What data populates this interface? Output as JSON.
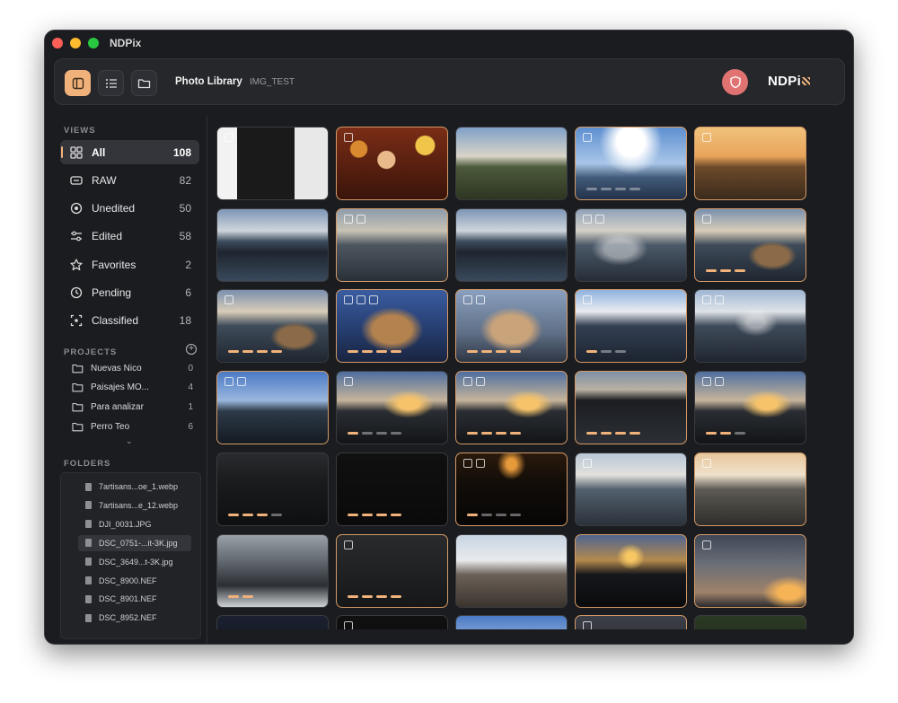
{
  "window": {
    "title": "NDPix"
  },
  "toolbar": {
    "title": "Photo Library",
    "subtitle": "IMG_TEST",
    "logo": "NDPi"
  },
  "accent": "#f0b27a",
  "sidebar": {
    "views_title": "VIEWS",
    "views": [
      {
        "icon": "grid-icon",
        "label": "All",
        "count": "108",
        "selected": true
      },
      {
        "icon": "raw-icon",
        "label": "RAW",
        "count": "82"
      },
      {
        "icon": "circle-icon",
        "label": "Unedited",
        "count": "50"
      },
      {
        "icon": "sliders-icon",
        "label": "Edited",
        "count": "58"
      },
      {
        "icon": "star-icon",
        "label": "Favorites",
        "count": "2"
      },
      {
        "icon": "clock-icon",
        "label": "Pending",
        "count": "6"
      },
      {
        "icon": "classified-icon",
        "label": "Classified",
        "count": "18"
      }
    ],
    "projects_title": "PROJECTS",
    "projects": [
      {
        "label": "Nuevas Nico",
        "count": "0"
      },
      {
        "label": "Paisajes MO...",
        "count": "4"
      },
      {
        "label": "Para analizar",
        "count": "1"
      },
      {
        "label": "Perro Teo",
        "count": "6"
      }
    ],
    "folders_title": "FOLDERS",
    "files": [
      {
        "label": "7artisans...oe_1.webp"
      },
      {
        "label": "7artisans...e_12.webp"
      },
      {
        "label": "DJI_0031.JPG"
      },
      {
        "label": "DSC_0751-...it-3K.jpg",
        "selected": true
      },
      {
        "label": "DSC_3649...t-3K.jpg"
      },
      {
        "label": "DSC_8900.NEF"
      },
      {
        "label": "DSC_8901.NEF"
      },
      {
        "label": "DSC_8952.NEF"
      }
    ]
  },
  "thumbnails": [
    {
      "scene": "lens",
      "edited": false,
      "badges": 1,
      "progress": 0
    },
    {
      "scene": "portrait",
      "edited": true,
      "badges": 1,
      "progress": 0
    },
    {
      "scene": "sunset-field",
      "edited": false,
      "badges": 0,
      "progress": 0
    },
    {
      "scene": "bright-sky",
      "edited": true,
      "badges": 1,
      "progress": 4,
      "done": 0
    },
    {
      "scene": "golden-sea",
      "edited": true,
      "badges": 1,
      "progress": 0
    },
    {
      "scene": "rocky-coast",
      "edited": false,
      "badges": 0,
      "progress": 0
    },
    {
      "scene": "rocky-coast-soft",
      "edited": true,
      "badges": 2,
      "progress": 0
    },
    {
      "scene": "rocky-coast",
      "edited": false,
      "badges": 0,
      "progress": 0
    },
    {
      "scene": "dog-coast-ghost",
      "edited": false,
      "badges": 2,
      "progress": 0
    },
    {
      "scene": "dog-coast",
      "edited": true,
      "badges": 1,
      "progress": 3,
      "done": 3
    },
    {
      "scene": "dog-coast",
      "edited": false,
      "badges": 1,
      "progress": 4,
      "done": 4
    },
    {
      "scene": "dog-face",
      "edited": true,
      "badges": 3,
      "progress": 4,
      "done": 4
    },
    {
      "scene": "dog-face-soft",
      "edited": true,
      "badges": 2,
      "progress": 4,
      "done": 4
    },
    {
      "scene": "coast-bright",
      "edited": true,
      "badges": 1,
      "progress": 3,
      "done": 1
    },
    {
      "scene": "coast-ghost",
      "edited": false,
      "badges": 2,
      "progress": 0
    },
    {
      "scene": "blue-sky",
      "edited": true,
      "badges": 2,
      "progress": 0
    },
    {
      "scene": "sunset-coast",
      "edited": false,
      "badges": 1,
      "progress": 4,
      "done": 1
    },
    {
      "scene": "sunset-coast",
      "edited": true,
      "badges": 2,
      "progress": 4,
      "done": 4
    },
    {
      "scene": "dark-coast",
      "edited": true,
      "badges": 0,
      "progress": 4,
      "done": 4
    },
    {
      "scene": "sunset-coast",
      "edited": false,
      "badges": 2,
      "progress": 3,
      "done": 2
    },
    {
      "scene": "night-coast",
      "edited": false,
      "badges": 0,
      "progress": 4,
      "done": 3
    },
    {
      "scene": "black",
      "edited": false,
      "badges": 0,
      "progress": 4,
      "done": 4
    },
    {
      "scene": "dark-sunset",
      "edited": true,
      "badges": 2,
      "progress": 4,
      "done": 1
    },
    {
      "scene": "waves",
      "edited": false,
      "badges": 1,
      "progress": 0
    },
    {
      "scene": "waves-warm",
      "edited": true,
      "badges": 1,
      "progress": 0
    },
    {
      "scene": "waves-bw",
      "edited": false,
      "badges": 0,
      "progress": 2,
      "done": 2
    },
    {
      "scene": "dark-gray",
      "edited": true,
      "badges": 1,
      "progress": 4,
      "done": 4
    },
    {
      "scene": "boulders",
      "edited": false,
      "badges": 0,
      "progress": 0
    },
    {
      "scene": "dusk-sun",
      "edited": true,
      "badges": 0,
      "progress": 0
    },
    {
      "scene": "storm-sunset",
      "edited": true,
      "badges": 1,
      "progress": 0
    },
    {
      "scene": "night-sky",
      "edited": false,
      "badges": 0,
      "progress": 0
    },
    {
      "scene": "black",
      "edited": false,
      "badges": 1,
      "progress": 0
    },
    {
      "scene": "blue-sky",
      "edited": false,
      "badges": 0,
      "progress": 0
    },
    {
      "scene": "milky",
      "edited": true,
      "badges": 1,
      "progress": 0
    },
    {
      "scene": "grass",
      "edited": false,
      "badges": 0,
      "progress": 0
    }
  ]
}
